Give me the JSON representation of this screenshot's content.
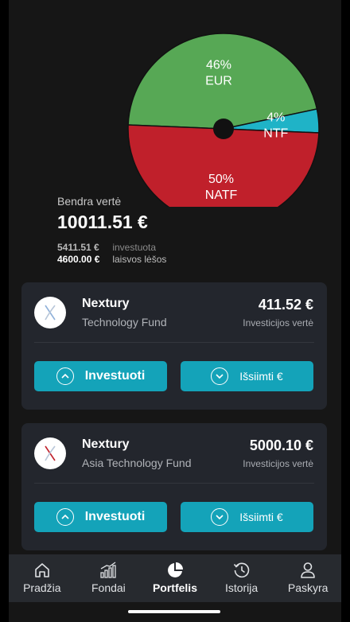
{
  "chart_data": {
    "type": "pie",
    "slices": [
      {
        "label": "EUR",
        "percent": 46,
        "color": "#57a855"
      },
      {
        "label": "NTF",
        "percent": 4,
        "color": "#1fb3c7"
      },
      {
        "label": "NATF",
        "percent": 50,
        "color": "#c0202b"
      }
    ]
  },
  "summary": {
    "total_label": "Bendra vertė",
    "total_value": "10011.51 €",
    "invested_amount": "5411.51 €",
    "invested_label": "investuota",
    "free_amount": "4600.00 €",
    "free_label": "laisvos lėšos"
  },
  "funds": [
    {
      "name": "Nextury",
      "subtitle": "Technology Fund",
      "value": "411.52 €",
      "value_label": "Investicijos vertė",
      "invest_label": "Investuoti",
      "withdraw_label": "Išsiimti €",
      "logo_color": "#8fb0d9"
    },
    {
      "name": "Nextury",
      "subtitle": "Asia Technology Fund",
      "value": "5000.10 €",
      "value_label": "Investicijos vertė",
      "invest_label": "Investuoti",
      "withdraw_label": "Išsiimti €",
      "logo_color": "#c0202b"
    }
  ],
  "nav": {
    "home": "Pradžia",
    "funds": "Fondai",
    "portfolio": "Portfelis",
    "history": "Istorija",
    "account": "Paskyra",
    "active": "portfolio"
  }
}
